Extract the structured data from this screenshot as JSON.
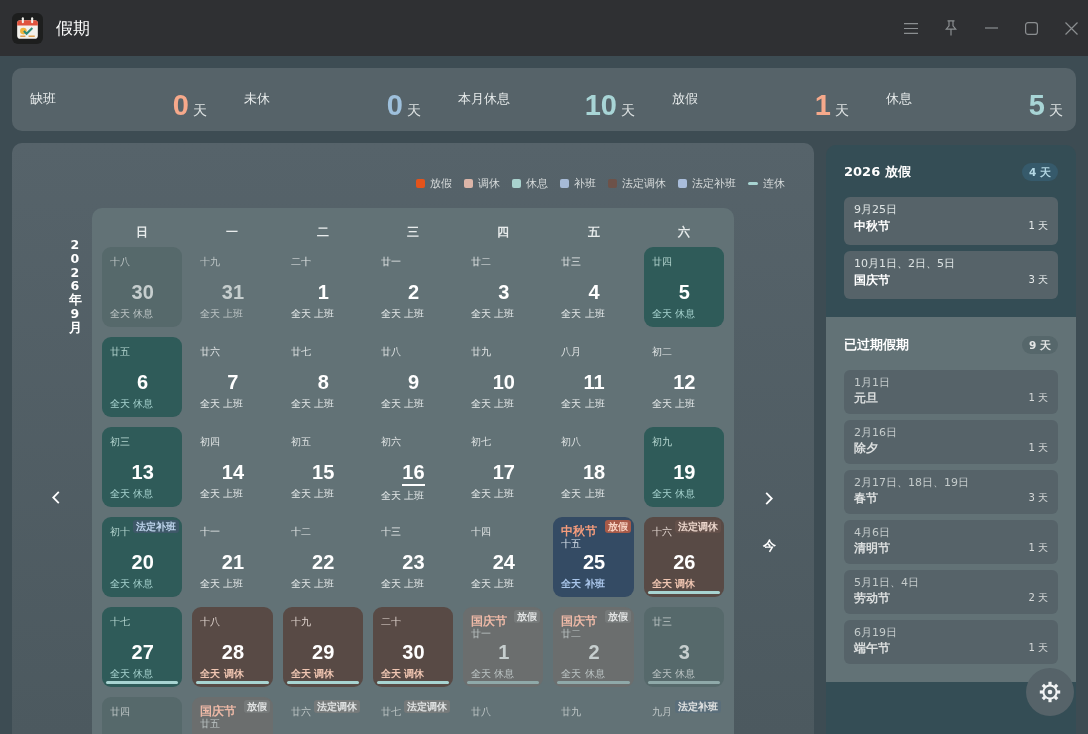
{
  "window": {
    "title": "假期"
  },
  "stats": [
    {
      "label": "缺班",
      "value": "0",
      "unit": "天",
      "color": "#f6a98b"
    },
    {
      "label": "未休",
      "value": "0",
      "unit": "天",
      "color": "#9ec0dc"
    },
    {
      "label": "本月休息",
      "value": "10",
      "unit": "天",
      "color": "#a8d5d6"
    },
    {
      "label": "放假",
      "value": "1",
      "unit": "天",
      "color": "#f6a98b"
    },
    {
      "label": "休息",
      "value": "5",
      "unit": "天",
      "color": "#a8d5d6"
    }
  ],
  "calendar": {
    "month_label": "2026年9月",
    "legend": [
      {
        "label": "放假",
        "color": "#e4531b",
        "kind": "swatch"
      },
      {
        "label": "调休",
        "color": "#dcb5a8",
        "kind": "swatch"
      },
      {
        "label": "休息",
        "color": "#a9d2ce",
        "kind": "swatch"
      },
      {
        "label": "补班",
        "color": "#a6bad6",
        "kind": "swatch"
      },
      {
        "label": "法定调休",
        "color": "#6d5249",
        "kind": "swatch"
      },
      {
        "label": "法定补班",
        "color": "#a9bddb",
        "kind": "swatch"
      },
      {
        "label": "连休",
        "color": "#a8d4d2",
        "kind": "line"
      }
    ],
    "weekdays": [
      "日",
      "一",
      "二",
      "三",
      "四",
      "五",
      "六"
    ],
    "weeks": [
      [
        {
          "day": "30",
          "lunar": "十八",
          "status": "全天 休息",
          "kind": "rest",
          "other_month": true,
          "today": false,
          "streak": false
        },
        {
          "day": "31",
          "lunar": "十九",
          "status": "全天 上班",
          "kind": "work",
          "other_month": true,
          "today": false,
          "streak": false
        },
        {
          "day": "1",
          "lunar": "二十",
          "status": "全天 上班",
          "kind": "work",
          "other_month": false,
          "today": false,
          "streak": false
        },
        {
          "day": "2",
          "lunar": "廿一",
          "status": "全天 上班",
          "kind": "work",
          "other_month": false,
          "today": false,
          "streak": false
        },
        {
          "day": "3",
          "lunar": "廿二",
          "status": "全天 上班",
          "kind": "work",
          "other_month": false,
          "today": false,
          "streak": false
        },
        {
          "day": "4",
          "lunar": "廿三",
          "status": "全天 上班",
          "kind": "work",
          "other_month": false,
          "today": false,
          "streak": false
        },
        {
          "day": "5",
          "lunar": "廿四",
          "status": "全天 休息",
          "kind": "rest",
          "other_month": false,
          "today": false,
          "streak": false
        }
      ],
      [
        {
          "day": "6",
          "lunar": "廿五",
          "status": "全天 休息",
          "kind": "rest",
          "other_month": false,
          "today": false,
          "streak": false
        },
        {
          "day": "7",
          "lunar": "廿六",
          "status": "全天 上班",
          "kind": "work",
          "other_month": false,
          "today": false,
          "streak": false
        },
        {
          "day": "8",
          "lunar": "廿七",
          "status": "全天 上班",
          "kind": "work",
          "other_month": false,
          "today": false,
          "streak": false
        },
        {
          "day": "9",
          "lunar": "廿八",
          "status": "全天 上班",
          "kind": "work",
          "other_month": false,
          "today": false,
          "streak": false
        },
        {
          "day": "10",
          "lunar": "廿九",
          "status": "全天 上班",
          "kind": "work",
          "other_month": false,
          "today": false,
          "streak": false
        },
        {
          "day": "11",
          "lunar": "八月",
          "status": "全天 上班",
          "kind": "work",
          "other_month": false,
          "today": false,
          "streak": false
        },
        {
          "day": "12",
          "lunar": "初二",
          "status": "全天 上班",
          "kind": "work",
          "other_month": false,
          "today": false,
          "streak": false
        }
      ],
      [
        {
          "day": "13",
          "lunar": "初三",
          "status": "全天 休息",
          "kind": "rest",
          "other_month": false,
          "today": false,
          "streak": false
        },
        {
          "day": "14",
          "lunar": "初四",
          "status": "全天 上班",
          "kind": "work",
          "other_month": false,
          "today": false,
          "streak": false
        },
        {
          "day": "15",
          "lunar": "初五",
          "status": "全天 上班",
          "kind": "work",
          "other_month": false,
          "today": false,
          "streak": false
        },
        {
          "day": "16",
          "lunar": "初六",
          "status": "全天 上班",
          "kind": "work",
          "other_month": false,
          "today": true,
          "streak": false
        },
        {
          "day": "17",
          "lunar": "初七",
          "status": "全天 上班",
          "kind": "work",
          "other_month": false,
          "today": false,
          "streak": false
        },
        {
          "day": "18",
          "lunar": "初八",
          "status": "全天 上班",
          "kind": "work",
          "other_month": false,
          "today": false,
          "streak": false
        },
        {
          "day": "19",
          "lunar": "初九",
          "status": "全天 休息",
          "kind": "rest",
          "other_month": false,
          "today": false,
          "streak": false
        }
      ],
      [
        {
          "day": "20",
          "lunar": "初十",
          "status": "全天 休息",
          "kind": "rest",
          "tag": {
            "text": "法定补班",
            "kind": "makeup"
          },
          "other_month": false,
          "today": false,
          "streak": false
        },
        {
          "day": "21",
          "lunar": "十一",
          "status": "全天 上班",
          "kind": "work",
          "other_month": false,
          "today": false,
          "streak": false
        },
        {
          "day": "22",
          "lunar": "十二",
          "status": "全天 上班",
          "kind": "work",
          "other_month": false,
          "today": false,
          "streak": false
        },
        {
          "day": "23",
          "lunar": "十三",
          "status": "全天 上班",
          "kind": "work",
          "other_month": false,
          "today": false,
          "streak": false
        },
        {
          "day": "24",
          "lunar": "十四",
          "status": "全天 上班",
          "kind": "work",
          "other_month": false,
          "today": false,
          "streak": false
        },
        {
          "day": "25",
          "holiday": "中秋节",
          "lunar": "十五",
          "status": "全天 补班",
          "kind": "makeup",
          "tag": {
            "text": "放假",
            "kind": "holiday"
          },
          "other_month": false,
          "today": false,
          "streak": false
        },
        {
          "day": "26",
          "lunar": "十六",
          "status": "全天 调休",
          "kind": "adjust",
          "tag": {
            "text": "法定调休",
            "kind": "adjust"
          },
          "other_month": false,
          "today": false,
          "streak": true
        }
      ],
      [
        {
          "day": "27",
          "lunar": "十七",
          "status": "全天 休息",
          "kind": "rest",
          "other_month": false,
          "today": false,
          "streak": true
        },
        {
          "day": "28",
          "lunar": "十八",
          "status": "全天 调休",
          "kind": "adjust",
          "other_month": false,
          "today": false,
          "streak": true
        },
        {
          "day": "29",
          "lunar": "十九",
          "status": "全天 调休",
          "kind": "adjust",
          "other_month": false,
          "today": false,
          "streak": true
        },
        {
          "day": "30",
          "lunar": "二十",
          "status": "全天 调休",
          "kind": "adjust",
          "other_month": false,
          "today": false,
          "streak": true
        },
        {
          "day": "1",
          "holiday": "国庆节",
          "lunar": "廿一",
          "status": "全天 休息",
          "kind": "holiday",
          "tag": {
            "text": "放假",
            "kind": "holiday"
          },
          "other_month": true,
          "today": false,
          "streak": true
        },
        {
          "day": "2",
          "holiday": "国庆节",
          "lunar": "廿二",
          "status": "全天 休息",
          "kind": "holiday",
          "tag": {
            "text": "放假",
            "kind": "holiday"
          },
          "other_month": true,
          "today": false,
          "streak": true
        },
        {
          "day": "3",
          "lunar": "廿三",
          "status": "全天 休息",
          "kind": "rest",
          "other_month": true,
          "today": false,
          "streak": true
        }
      ],
      [
        {
          "lunar": "廿四",
          "kind": "rest",
          "other_month": true
        },
        {
          "holiday": "国庆节",
          "lunar": "廿五",
          "kind": "holiday",
          "tag": {
            "text": "放假",
            "kind": "holiday"
          },
          "other_month": true
        },
        {
          "lunar": "廿六",
          "kind": "work",
          "tag": {
            "text": "法定调休",
            "kind": "adjust"
          },
          "other_month": true
        },
        {
          "lunar": "廿七",
          "kind": "work",
          "tag": {
            "text": "法定调休",
            "kind": "adjust"
          },
          "other_month": true
        },
        {
          "lunar": "廿八",
          "kind": "work",
          "other_month": true
        },
        {
          "lunar": "廿九",
          "kind": "work",
          "other_month": true
        },
        {
          "lunar": "九月",
          "kind": "work",
          "tag": {
            "text": "法定补班",
            "kind": "makeup"
          },
          "other_month": true
        }
      ]
    ],
    "today_button": "今"
  },
  "sidebar": {
    "upcoming": {
      "title": "2026 放假",
      "total": "4 天",
      "items": [
        {
          "dates": "9月25日",
          "name": "中秋节",
          "days": "1 天"
        },
        {
          "dates": "10月1日、2日、5日",
          "name": "国庆节",
          "days": "3 天"
        }
      ]
    },
    "past": {
      "title": "已过期假期",
      "total": "9 天",
      "items": [
        {
          "dates": "1月1日",
          "name": "元旦",
          "days": "1 天"
        },
        {
          "dates": "2月16日",
          "name": "除夕",
          "days": "1 天"
        },
        {
          "dates": "2月17日、18日、19日",
          "name": "春节",
          "days": "3 天"
        },
        {
          "dates": "4月6日",
          "name": "清明节",
          "days": "1 天"
        },
        {
          "dates": "5月1日、4日",
          "name": "劳动节",
          "days": "2 天"
        },
        {
          "dates": "6月19日",
          "name": "端午节",
          "days": "1 天"
        }
      ]
    }
  }
}
